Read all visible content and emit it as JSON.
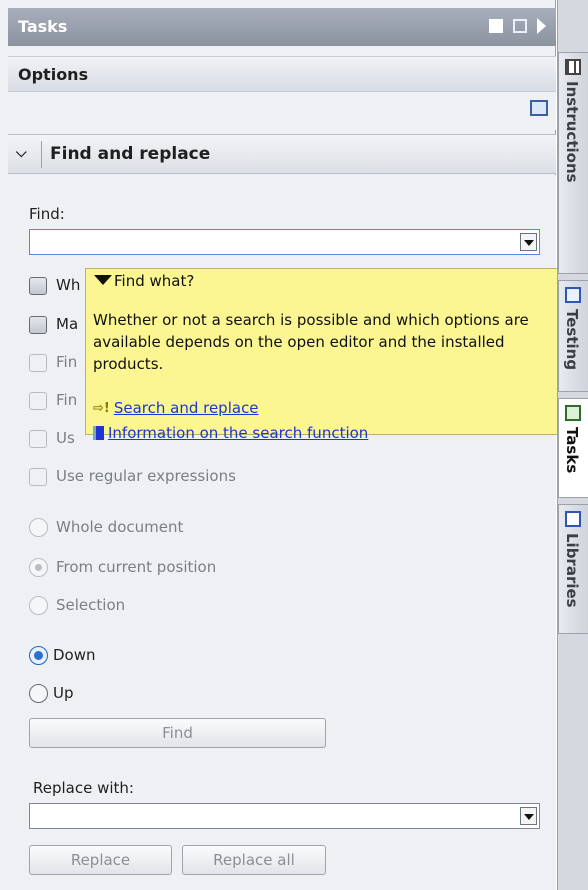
{
  "titlebar": {
    "title": "Tasks"
  },
  "options": {
    "label": "Options"
  },
  "find_replace": {
    "header": "Find and replace",
    "find_label": "Find:",
    "find_value": "",
    "checkboxes": [
      {
        "label": "Whole words only",
        "visible": "Wh",
        "checked": false,
        "enabled": true
      },
      {
        "label": "Match case",
        "visible": "Ma",
        "checked": false,
        "enabled": true
      },
      {
        "label": "Find in substructures",
        "visible": "Fin",
        "checked": false,
        "enabled": false
      },
      {
        "label": "Find in hidden texts",
        "visible": "Fin",
        "checked": false,
        "enabled": false
      },
      {
        "label": "Use wildcards",
        "visible": "Us",
        "checked": false,
        "enabled": false
      },
      {
        "label": "Use regular expressions",
        "visible": "Use regular expressions",
        "checked": false,
        "enabled": false
      }
    ],
    "scope_options": [
      {
        "label": "Whole document",
        "checked": false,
        "enabled": false
      },
      {
        "label": "From current position",
        "checked": true,
        "enabled": false
      },
      {
        "label": "Selection",
        "checked": false,
        "enabled": false
      }
    ],
    "direction_options": [
      {
        "label": "Down",
        "checked": true
      },
      {
        "label": "Up",
        "checked": false
      }
    ],
    "find_button": "Find",
    "replace_label": "Replace with:",
    "replace_value": "",
    "replace_button": "Replace",
    "replace_all_button": "Replace all"
  },
  "tooltip": {
    "title": "Find what?",
    "description": "Whether or not a search is possible and which options are available depends on the open editor and the installed products.",
    "links": [
      {
        "text": "Search and replace",
        "icon": "link-arrow-icon"
      },
      {
        "text": "Information on the search function",
        "icon": "book-icon"
      }
    ]
  },
  "side_tabs": [
    {
      "label": "Instructions",
      "icon": "grid-icon",
      "active": false
    },
    {
      "label": "Testing",
      "icon": "testing-icon",
      "active": false
    },
    {
      "label": "Tasks",
      "icon": "tasks-icon",
      "active": true
    },
    {
      "label": "Libraries",
      "icon": "libraries-icon",
      "active": false
    }
  ],
  "colors": {
    "titlebar": "#9aa0ad",
    "tooltip_bg": "#fbf592",
    "link": "#1f34d6",
    "radio_accent": "#2c6fd1"
  }
}
